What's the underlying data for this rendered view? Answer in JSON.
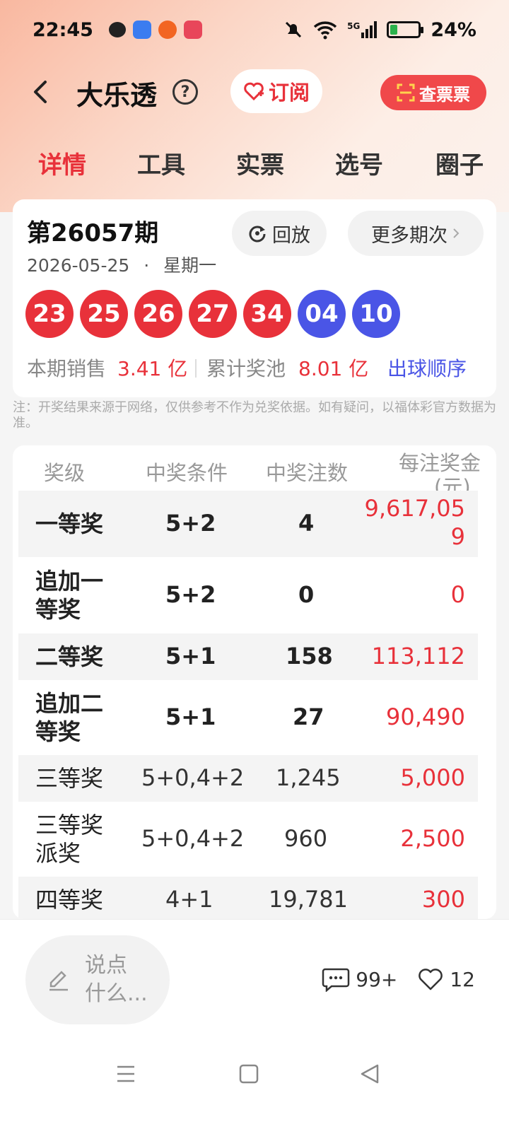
{
  "status": {
    "time": "22:45",
    "signal": "5G",
    "battery": "24%",
    "battery_level": 0.24
  },
  "header": {
    "title": "大乐透",
    "help": "?",
    "subscribe": "订阅",
    "check_ticket": "查票票"
  },
  "tabs": [
    "详情",
    "工具",
    "实票",
    "选号",
    "圈子"
  ],
  "draw": {
    "issue": "第26057期",
    "date": "2026-05-25",
    "weekday": "星期一",
    "dot": "·",
    "replay": "回放",
    "more": "更多期次",
    "red_balls": [
      "23",
      "25",
      "26",
      "27",
      "34"
    ],
    "blue_balls": [
      "04",
      "10"
    ],
    "sales_label": "本期销售",
    "sales_value": "3.41 亿",
    "pool_label": "累计奖池",
    "pool_value": "8.01 亿",
    "order_link": "出球顺序"
  },
  "note": "注：开奖结果来源于网络，仅供参考不作为兑奖依据。如有疑问，以福体彩官方数据为准。",
  "prize_table": {
    "headers": [
      "奖级",
      "中奖条件",
      "中奖注数",
      "每注奖金",
      "(元)"
    ],
    "rows": [
      {
        "name": "一等奖",
        "name2": "",
        "cond": "5+2",
        "count": "4",
        "amount": "9,617,05",
        "amount2": "9"
      },
      {
        "name": "追加一",
        "name2": "等奖",
        "cond": "5+2",
        "count": "0",
        "amount": "0",
        "amount2": ""
      },
      {
        "name": "二等奖",
        "name2": "",
        "cond": "5+1",
        "count": "158",
        "amount": "113,112",
        "amount2": ""
      },
      {
        "name": "追加二",
        "name2": "等奖",
        "cond": "5+1",
        "count": "27",
        "amount": "90,490",
        "amount2": ""
      },
      {
        "name": "三等奖",
        "name2": "",
        "cond": "5+0,4+2",
        "count": "1,245",
        "amount": "5,000",
        "amount2": ""
      },
      {
        "name": "三等奖",
        "name2": "派奖",
        "cond": "5+0,4+2",
        "count": "960",
        "amount": "2,500",
        "amount2": ""
      },
      {
        "name": "四等奖",
        "name2": "",
        "cond": "4+1",
        "count": "19,781",
        "amount": "300",
        "amount2": ""
      }
    ]
  },
  "bottom": {
    "comment_line1": "说点",
    "comment_line2": "什么...",
    "comments": "99+",
    "likes": "12"
  }
}
